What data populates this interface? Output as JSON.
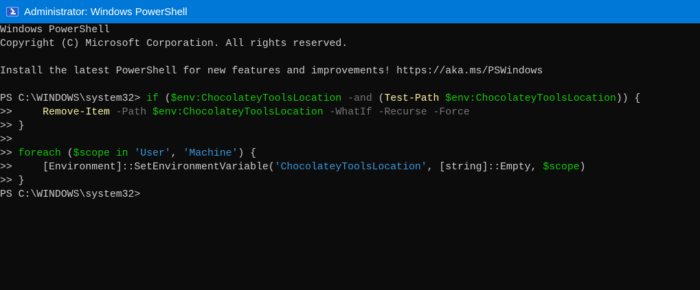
{
  "window": {
    "title": "Administrator: Windows PowerShell"
  },
  "colors": {
    "titlebar": "#0078d7",
    "background": "#0c0c0c",
    "default": "#cccccc",
    "green": "#16c60c",
    "blue": "#3a96dd",
    "yellow": "#f9f1a5",
    "gray": "#767676"
  },
  "console": {
    "lines": [
      [
        [
          "def",
          "Windows PowerShell"
        ]
      ],
      [
        [
          "def",
          "Copyright (C) Microsoft Corporation. All rights reserved."
        ]
      ],
      [],
      [
        [
          "def",
          "Install the latest PowerShell for new features and improvements! https://aka.ms/PSWindows"
        ]
      ],
      [],
      [
        [
          "def",
          "PS C:\\WINDOWS\\system32> "
        ],
        [
          "grn",
          "if"
        ],
        [
          "def",
          " ("
        ],
        [
          "grn",
          "$env:ChocolateyToolsLocation"
        ],
        [
          "gry",
          " -and"
        ],
        [
          "def",
          " ("
        ],
        [
          "yel",
          "Test-Path"
        ],
        [
          "def",
          " "
        ],
        [
          "grn",
          "$env:ChocolateyToolsLocation"
        ],
        [
          "def",
          ")) {"
        ]
      ],
      [
        [
          "def",
          ">>     "
        ],
        [
          "yel",
          "Remove-Item"
        ],
        [
          "gry",
          " -Path"
        ],
        [
          "def",
          " "
        ],
        [
          "grn",
          "$env:ChocolateyToolsLocation"
        ],
        [
          "gry",
          " -WhatIf -Recurse -Force"
        ]
      ],
      [
        [
          "def",
          ">> }"
        ]
      ],
      [
        [
          "def",
          ">>"
        ]
      ],
      [
        [
          "def",
          ">> "
        ],
        [
          "grn",
          "foreach"
        ],
        [
          "def",
          " ("
        ],
        [
          "grn",
          "$scope"
        ],
        [
          "grn",
          " in"
        ],
        [
          "def",
          " "
        ],
        [
          "blu",
          "'User'"
        ],
        [
          "def",
          ", "
        ],
        [
          "blu",
          "'Machine'"
        ],
        [
          "def",
          ") {"
        ]
      ],
      [
        [
          "def",
          ">>     [Environment]::SetEnvironmentVariable("
        ],
        [
          "blu",
          "'ChocolateyToolsLocation'"
        ],
        [
          "def",
          ", [string]::Empty, "
        ],
        [
          "grn",
          "$scope"
        ],
        [
          "def",
          ")"
        ]
      ],
      [
        [
          "def",
          ">> }"
        ]
      ],
      [
        [
          "def",
          "PS C:\\WINDOWS\\system32>"
        ]
      ]
    ]
  }
}
